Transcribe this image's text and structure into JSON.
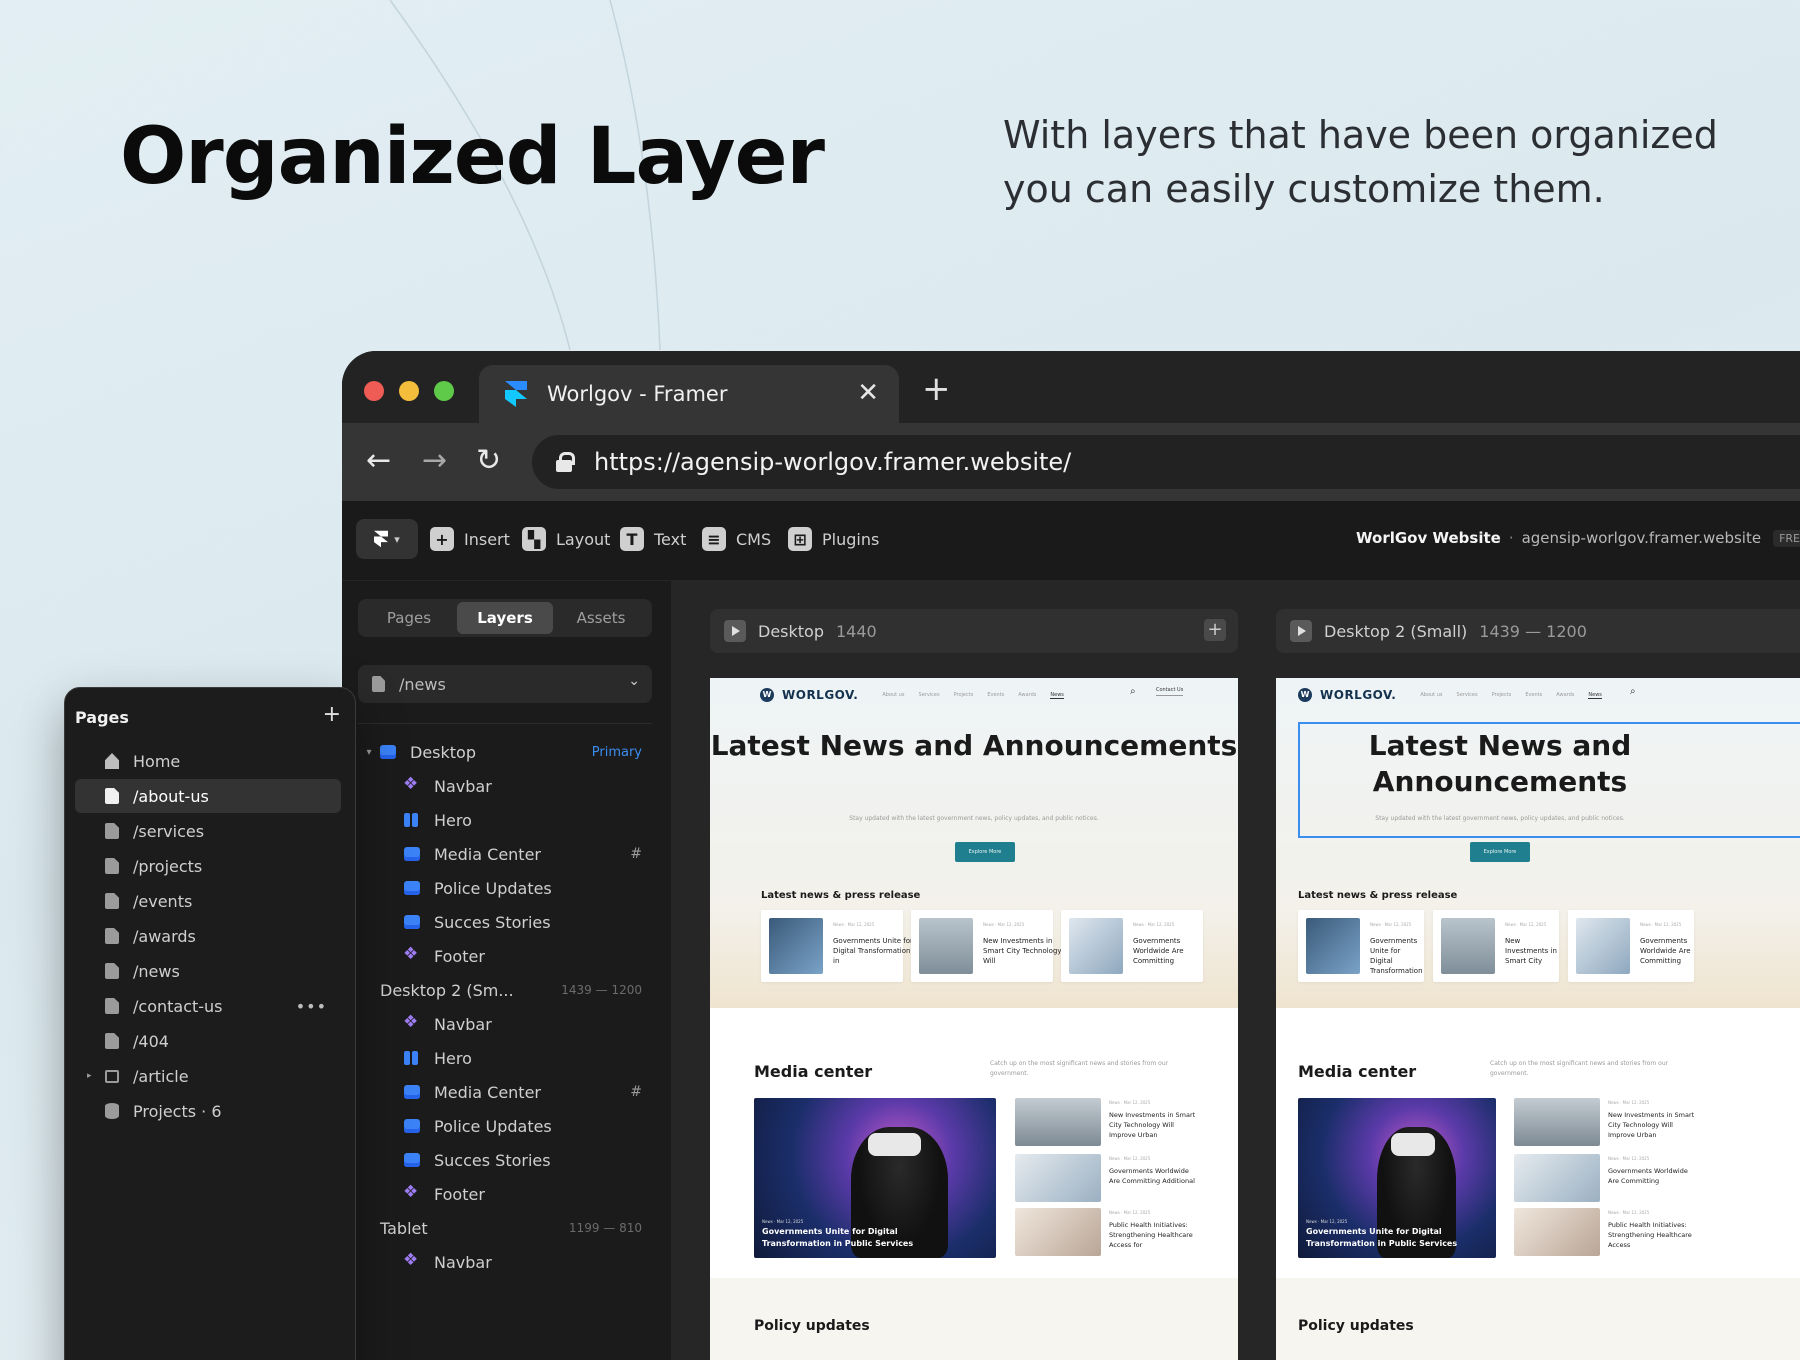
{
  "hero": {
    "title": "Organized Layer",
    "subtitle": "With layers that have been organized you can easily customize them."
  },
  "browser": {
    "tab_title": "Worlgov - Framer",
    "tab_close": "✕",
    "new_tab": "+",
    "url": "https://agensip-worlgov.framer.website/",
    "back_icon": "←",
    "forward_icon": "→",
    "reload_icon": "↻"
  },
  "toolbar": {
    "items": [
      {
        "label": "Insert",
        "icon": "+"
      },
      {
        "label": "Layout",
        "icon": "▚"
      },
      {
        "label": "Text",
        "icon": "T"
      },
      {
        "label": "CMS",
        "icon": "≡"
      },
      {
        "label": "Plugins",
        "icon": "⊞"
      }
    ],
    "site_name": "WorlGov Website",
    "site_dot": "·",
    "site_url": "agensip-worlgov.framer.website",
    "plan_badge": "FREE"
  },
  "layers_panel": {
    "tabs": [
      "Pages",
      "Layers",
      "Assets"
    ],
    "active_tab": "Layers",
    "current_page": "/news",
    "layers": [
      {
        "label": "Desktop",
        "icon": "stack",
        "badge": "Primary",
        "indent": 0,
        "caret": "▾"
      },
      {
        "label": "Navbar",
        "icon": "component",
        "indent": 1
      },
      {
        "label": "Hero",
        "icon": "hero",
        "indent": 1
      },
      {
        "label": "Media Center",
        "icon": "stack",
        "indent": 1,
        "hash": "#"
      },
      {
        "label": "Police Updates",
        "icon": "stack",
        "indent": 1
      },
      {
        "label": "Succes Stories",
        "icon": "stack",
        "indent": 1
      },
      {
        "label": "Footer",
        "icon": "component",
        "indent": 1
      },
      {
        "label": "Desktop 2 (Sm...",
        "icon": "none",
        "indent": 0,
        "meta": "1439 — 1200"
      },
      {
        "label": "Navbar",
        "icon": "component",
        "indent": 1
      },
      {
        "label": "Hero",
        "icon": "hero",
        "indent": 1
      },
      {
        "label": "Media Center",
        "icon": "stack",
        "indent": 1,
        "hash": "#"
      },
      {
        "label": "Police Updates",
        "icon": "stack",
        "indent": 1
      },
      {
        "label": "Succes Stories",
        "icon": "stack",
        "indent": 1
      },
      {
        "label": "Footer",
        "icon": "component",
        "indent": 1
      },
      {
        "label": "Tablet",
        "icon": "none",
        "indent": 0,
        "meta": "1199 — 810"
      },
      {
        "label": "Navbar",
        "icon": "component",
        "indent": 1
      }
    ]
  },
  "canvas": {
    "frames": [
      {
        "name": "Desktop",
        "size": "1440",
        "plus": "+"
      },
      {
        "name": "Desktop 2 (Small)",
        "size": "1439 — 1200"
      }
    ],
    "site": {
      "brand": "WORLGOV.",
      "logo_letter": "W",
      "nav_links": [
        "About us",
        "Services",
        "Projects",
        "Events",
        "Awards",
        "News"
      ],
      "active_nav": "News",
      "search_icon": "⌕",
      "contact": "Contact Us",
      "title": "Latest News and Announcements",
      "subtitle": "Stay updated with the latest government news, policy updates, and public notices.",
      "button": "Explore More",
      "latest_label": "Latest news & press release",
      "cards": [
        {
          "meta": "News · Mar 12, 2025",
          "text": "Governments Unite for Digital Transformation in"
        },
        {
          "meta": "News · Mar 12, 2025",
          "text": "New Investments in Smart City Technology Will"
        },
        {
          "meta": "News · Mar 12, 2025",
          "text": "Governments Worldwide Are Committing"
        }
      ],
      "cards_small": [
        {
          "meta": "News · Mar 12, 2025",
          "text": "Governments Unite for Digital Transformation"
        },
        {
          "meta": "News · Mar 12, 2025",
          "text": "New Investments in Smart City"
        },
        {
          "meta": "News · Mar 12, 2025",
          "text": "Governments Worldwide Are Committing"
        }
      ],
      "media_title": "Media center",
      "media_desc": "Catch up on the most significant news and stories from our government.",
      "media_big_meta": "News · Mar 12, 2025",
      "media_big_caption": "Governments Unite for Digital Transformation in Public Services",
      "media_list": [
        {
          "meta": "News · Mar 12, 2025",
          "text": "New Investments in Smart City Technology Will Improve Urban"
        },
        {
          "meta": "News · Mar 12, 2025",
          "text": "Governments Worldwide Are Committing Additional"
        },
        {
          "meta": "News · Mar 12, 2025",
          "text": "Public Health Initiatives: Strengthening Healthcare Access for"
        }
      ],
      "media_list_small": [
        {
          "meta": "News · Mar 12, 2025",
          "text": "New Investments in Smart City Technology Will Improve Urban"
        },
        {
          "meta": "News · Mar 12, 2025",
          "text": "Governments Worldwide Are Committing"
        },
        {
          "meta": "News · Mar 12, 2025",
          "text": "Public Health Initiatives: Strengthening Healthcare Access"
        }
      ],
      "policy_title": "Policy updates"
    }
  },
  "pages_panel": {
    "title": "Pages",
    "add_icon": "+",
    "items": [
      {
        "label": "Home",
        "icon": "home"
      },
      {
        "label": "/about-us",
        "icon": "file",
        "active": true
      },
      {
        "label": "/services",
        "icon": "file"
      },
      {
        "label": "/projects",
        "icon": "file"
      },
      {
        "label": "/events",
        "icon": "file"
      },
      {
        "label": "/awards",
        "icon": "file"
      },
      {
        "label": "/news",
        "icon": "file"
      },
      {
        "label": "/contact-us",
        "icon": "file",
        "more": "•••"
      },
      {
        "label": "/404",
        "icon": "file"
      },
      {
        "label": "/article",
        "icon": "folder",
        "caret": "▸"
      },
      {
        "label": "Projects · 6",
        "icon": "db"
      }
    ]
  }
}
